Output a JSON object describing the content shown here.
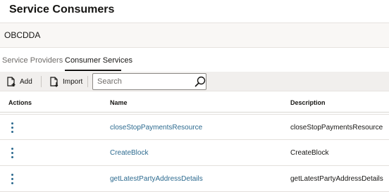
{
  "page": {
    "title": "Service Consumers"
  },
  "context": {
    "name": "OBCDDA"
  },
  "tabs": [
    {
      "label": "Service Providers",
      "active": false
    },
    {
      "label": "Consumer Services",
      "active": true
    }
  ],
  "toolbar": {
    "add_label": "Add",
    "import_label": "Import",
    "search_placeholder": "Search",
    "search_value": ""
  },
  "table": {
    "columns": [
      "Actions",
      "Name",
      "Description"
    ],
    "rows": [
      {
        "name": "closeStopPaymentsResource",
        "description": "closeStopPaymentsResource"
      },
      {
        "name": "CreateBlock",
        "description": "CreateBlock"
      },
      {
        "name": "getLatestPartyAddressDetails",
        "description": "getLatestPartyAddressDetails"
      }
    ]
  },
  "colors": {
    "link": "#2c6a8f",
    "text": "#161513",
    "context_bg": "#f9f7f5",
    "toolbar_bg": "#f1efed"
  },
  "icons": {
    "add": "add-document-icon",
    "import": "import-document-icon",
    "search": "search-icon",
    "row_actions": "kebab-menu-icon"
  }
}
